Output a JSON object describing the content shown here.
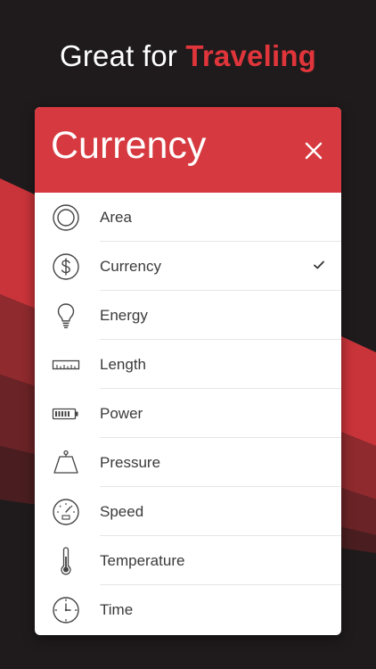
{
  "headline": {
    "prefix": "Great for ",
    "accent": "Traveling"
  },
  "colors": {
    "accent": "#d63a40",
    "background": "#1f1b1c"
  },
  "card": {
    "title": "Currency",
    "close_icon": "close-icon",
    "selected": "Currency",
    "items": [
      {
        "label": "Area",
        "icon": "area-icon"
      },
      {
        "label": "Currency",
        "icon": "currency-icon"
      },
      {
        "label": "Energy",
        "icon": "lightbulb-icon"
      },
      {
        "label": "Length",
        "icon": "ruler-icon"
      },
      {
        "label": "Power",
        "icon": "battery-icon"
      },
      {
        "label": "Pressure",
        "icon": "weight-icon"
      },
      {
        "label": "Speed",
        "icon": "speedometer-icon"
      },
      {
        "label": "Temperature",
        "icon": "thermometer-icon"
      },
      {
        "label": "Time",
        "icon": "clock-icon"
      }
    ]
  }
}
